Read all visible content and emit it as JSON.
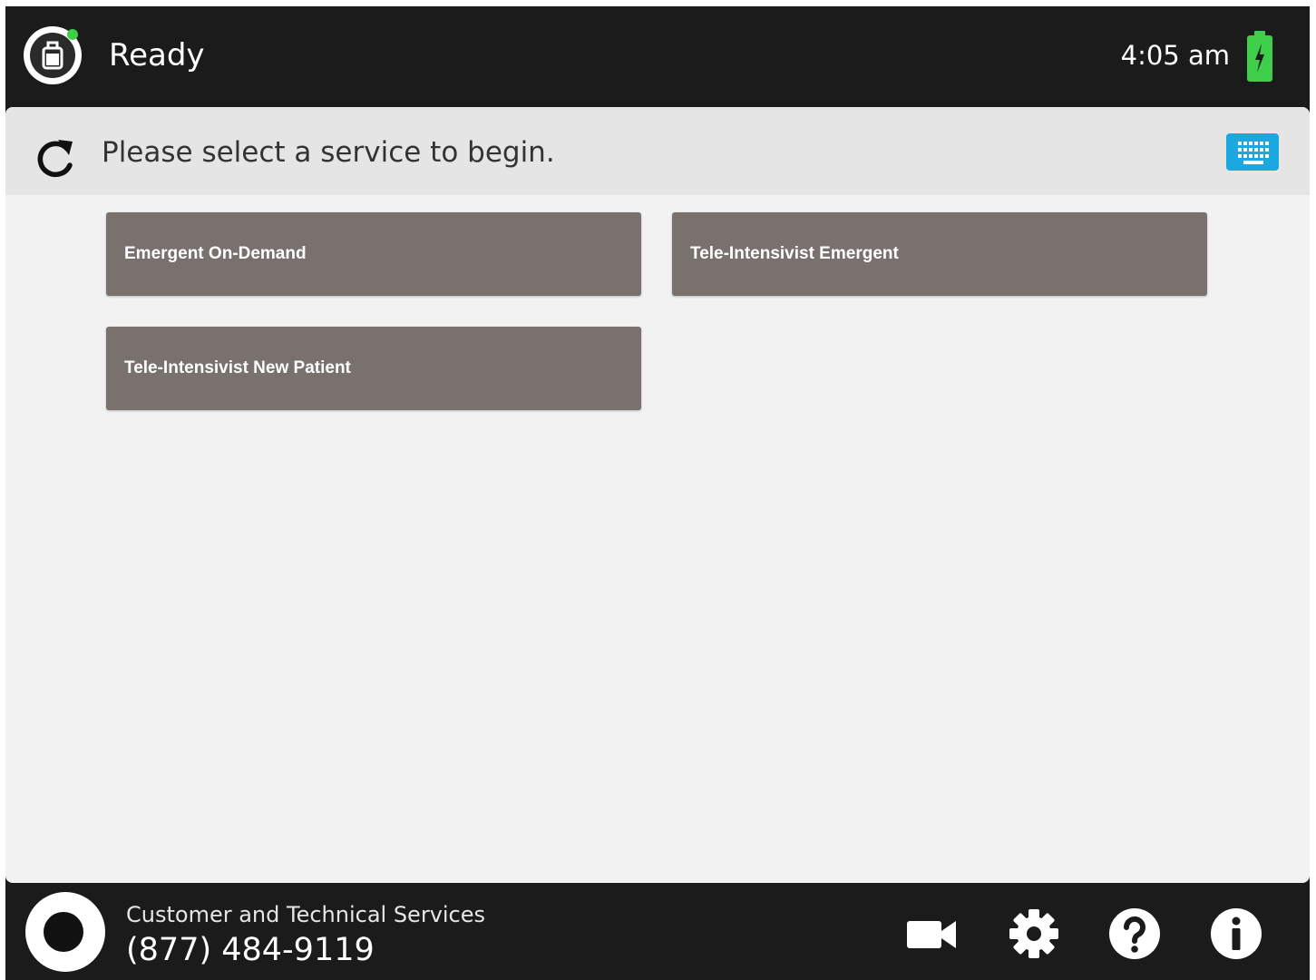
{
  "status_bar": {
    "status": "Ready",
    "time": "4:05 am",
    "battery_icon": "battery-charging-icon",
    "battery_color": "#3ecf4a",
    "online_color": "#3ecf4a"
  },
  "prompt": {
    "text": "Please select a service to begin.",
    "refresh_icon": "refresh-icon",
    "keyboard_icon": "keyboard-icon",
    "keyboard_color": "#1ba7e0"
  },
  "services": [
    {
      "label": "Emergent On-Demand"
    },
    {
      "label": "Tele-Intensivist Emergent"
    },
    {
      "label": "Tele-Intensivist New Patient"
    }
  ],
  "service_button_color": "#78716d",
  "footer": {
    "support_label": "Customer and Technical Services",
    "support_phone": "(877) 484-9119",
    "icons": [
      "video-camera-icon",
      "gear-icon",
      "help-icon",
      "info-icon"
    ],
    "brand_color": "#1ba7e0"
  }
}
